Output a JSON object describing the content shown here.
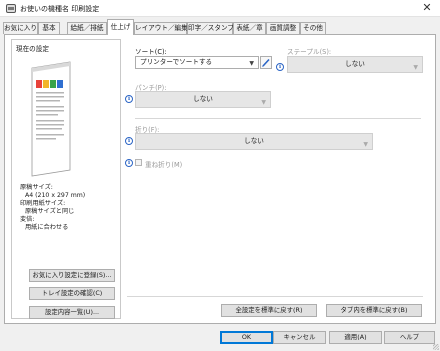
{
  "window": {
    "title": "お使いの機種名 印刷設定",
    "close_symbol": "✕"
  },
  "tabs": [
    {
      "label": "お気に入り"
    },
    {
      "label": "基本"
    },
    {
      "label": "給紙／排紙"
    },
    {
      "label": "仕上げ",
      "active": true
    },
    {
      "label": "レイアウト／編集"
    },
    {
      "label": "印字／スタンプ"
    },
    {
      "label": "表紙／章"
    },
    {
      "label": "画質調整"
    },
    {
      "label": "その他"
    }
  ],
  "current_settings": {
    "label": "現在の設定",
    "summary": [
      {
        "text": "原稿サイズ:",
        "indent": false
      },
      {
        "text": "A4 (210 x 297 mm)",
        "indent": true
      },
      {
        "text": "印刷用紙サイズ:",
        "indent": false
      },
      {
        "text": "原稿サイズと同じ",
        "indent": true
      },
      {
        "text": "変倍:",
        "indent": false
      },
      {
        "text": "用紙に合わせる",
        "indent": true
      }
    ],
    "buttons": {
      "register_favorite": "お気に入り設定に登録(S)...",
      "check_tray": "トレイ設定の確認(C)",
      "settings_list": "設定内容一覧(U)..."
    }
  },
  "finishing": {
    "sort": {
      "label": "ソート(C):",
      "value": "プリンターでソートする"
    },
    "staple": {
      "label": "ステープル(S):",
      "value": "しない"
    },
    "punch": {
      "label": "パンチ(P):",
      "value": "しない"
    },
    "fold": {
      "label": "折り(F):",
      "value": "しない"
    },
    "multi_fold": {
      "label": "重ね折り(M)",
      "checked": false
    },
    "info_symbol": "i"
  },
  "reset_buttons": {
    "reset_all": "全設定を標準に戻す(R)",
    "reset_tab": "タブ内を標準に戻す(B)"
  },
  "dialog_buttons": {
    "ok": "OK",
    "cancel": "キャンセル",
    "apply": "適用(A)",
    "help": "ヘルプ"
  },
  "colors": {
    "accent": "#0078d7",
    "info": "#2a64c5",
    "disabled_text": "#9a9a9a"
  }
}
